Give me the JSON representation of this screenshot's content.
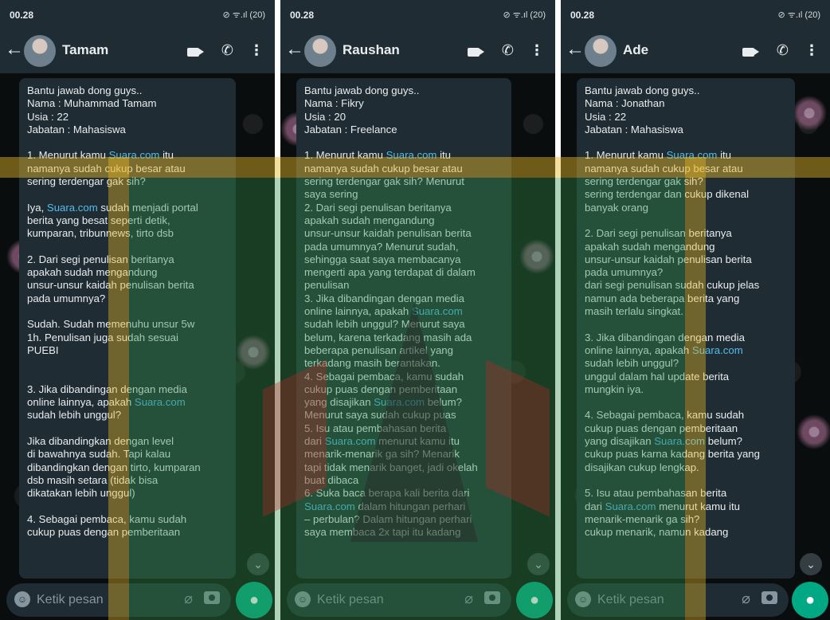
{
  "screenshots": [
    {
      "time": "00.28",
      "status_icons": "⊘ ᯤ.ıl (20)",
      "contact_name": "Tamam",
      "composer_placeholder": "Ketik pesan",
      "message_lines": [
        "Bantu jawab dong guys..",
        "Nama : Muhammad Tamam",
        "Usia : 22",
        "Jabatan : Mahasiswa",
        "",
        "1. Menurut kamu Suara.com itu",
        "namanya sudah cukup besar atau",
        "sering terdengar gak sih?",
        "",
        "Iya, Suara.com sudah menjadi portal",
        "berita yang besat seperti detik,",
        "kumparan, tribunnews, tirto dsb",
        "",
        "2. Dari segi penulisan beritanya",
        "apakah sudah mengandung",
        "unsur-unsur kaidah penulisan berita",
        "pada umumnya?",
        "",
        "Sudah. Sudah memenuhu unsur 5w",
        "1h. Penulisan juga sudah sesuai",
        "PUEBI",
        "",
        "",
        "3. Jika dibandingan dengan media",
        "online lainnya, apakah Suara.com",
        "sudah lebih unggul?",
        "",
        "Jika dibandingkan dengan level",
        "di bawahnya sudah. Tapi kalau",
        "dibandingkan dengan tirto, kumparan",
        "dsb masih setara (tidak bisa",
        "dikatakan lebih unggul)",
        "",
        "4. Sebagai pembaca, kamu sudah",
        "cukup puas dengan pemberitaan"
      ]
    },
    {
      "time": "00.28",
      "status_icons": "⊘ ᯤ.ıl (20)",
      "contact_name": "Raushan",
      "composer_placeholder": "Ketik pesan",
      "message_lines": [
        "Bantu jawab dong guys..",
        "Nama : Fikry",
        "Usia : 20",
        "Jabatan : Freelance",
        "",
        "1. Menurut kamu Suara.com itu",
        "namanya sudah cukup besar atau",
        "sering terdengar gak sih? Menurut",
        "saya sering",
        "2. Dari segi penulisan beritanya",
        "apakah sudah mengandung",
        "unsur-unsur kaidah penulisan berita",
        "pada umumnya? Menurut sudah,",
        "sehingga saat saya membacanya",
        "mengerti apa yang terdapat di dalam",
        "penulisan",
        "3. Jika dibandingan dengan media",
        "online lainnya, apakah Suara.com",
        "sudah lebih unggul? Menurut saya",
        "belum, karena terkadang masih ada",
        "beberapa penulisan artikel yang",
        "terkadang masih berantakan.",
        "4. Sebagai pembaca, kamu sudah",
        "cukup puas dengan pemberitaan",
        "yang disajikan Suara.com belum?",
        "Menurut saya sudah cukup puas",
        "5. Isu atau pembahasan berita",
        "dari Suara.com menurut kamu itu",
        "menarik-menarik ga sih? Menarik",
        "tapi tidak menarik banget, jadi okelah",
        "buat dibaca",
        "6. Suka baca berapa kali berita dari",
        "Suara.com dalam hitungan perhari",
        "– perbulan? Dalam hitungan perhari",
        "saya membaca 2x tapi itu kadang"
      ]
    },
    {
      "time": "00.28",
      "status_icons": "⊘ ᯤ.ıl (20)",
      "contact_name": "Ade",
      "composer_placeholder": "Ketik pesan",
      "message_lines": [
        "Bantu jawab dong guys..",
        "Nama : Jonathan",
        "Usia : 22",
        "Jabatan : Mahasiswa",
        "",
        "1. Menurut kamu Suara.com itu",
        "namanya sudah cukup besar atau",
        "sering terdengar gak sih?",
        "sering terdengar dan cukup dikenal",
        "banyak orang",
        "",
        "2. Dari segi penulisan beritanya",
        "apakah sudah mengandung",
        "unsur-unsur kaidah penulisan berita",
        "pada umumnya?",
        "dari segi penulisan sudah cukup jelas",
        "namun ada beberapa berita yang",
        "masih terlalu singkat.",
        "",
        "3. Jika dibandingan dengan media",
        "online lainnya, apakah Suara.com",
        "sudah lebih unggul?",
        "unggul dalam hal update berita",
        "mungkin iya.",
        "",
        "4. Sebagai pembaca, kamu sudah",
        "cukup puas dengan pemberitaan",
        "yang disajikan Suara.com belum?",
        "cukup puas karna kadang berita yang",
        "disajikan cukup lengkap.",
        "",
        "5. Isu atau pembahasan berita",
        "dari Suara.com menurut kamu itu",
        "menarik-menarik ga sih?",
        "cukup menarik, namun kadang"
      ]
    }
  ],
  "link_text": "Suara.com",
  "colors": {
    "header_bg": "#1f2c33",
    "bubble_bg": "#1f2c33",
    "link": "#53bdeb",
    "mic_green": "#00a884"
  }
}
